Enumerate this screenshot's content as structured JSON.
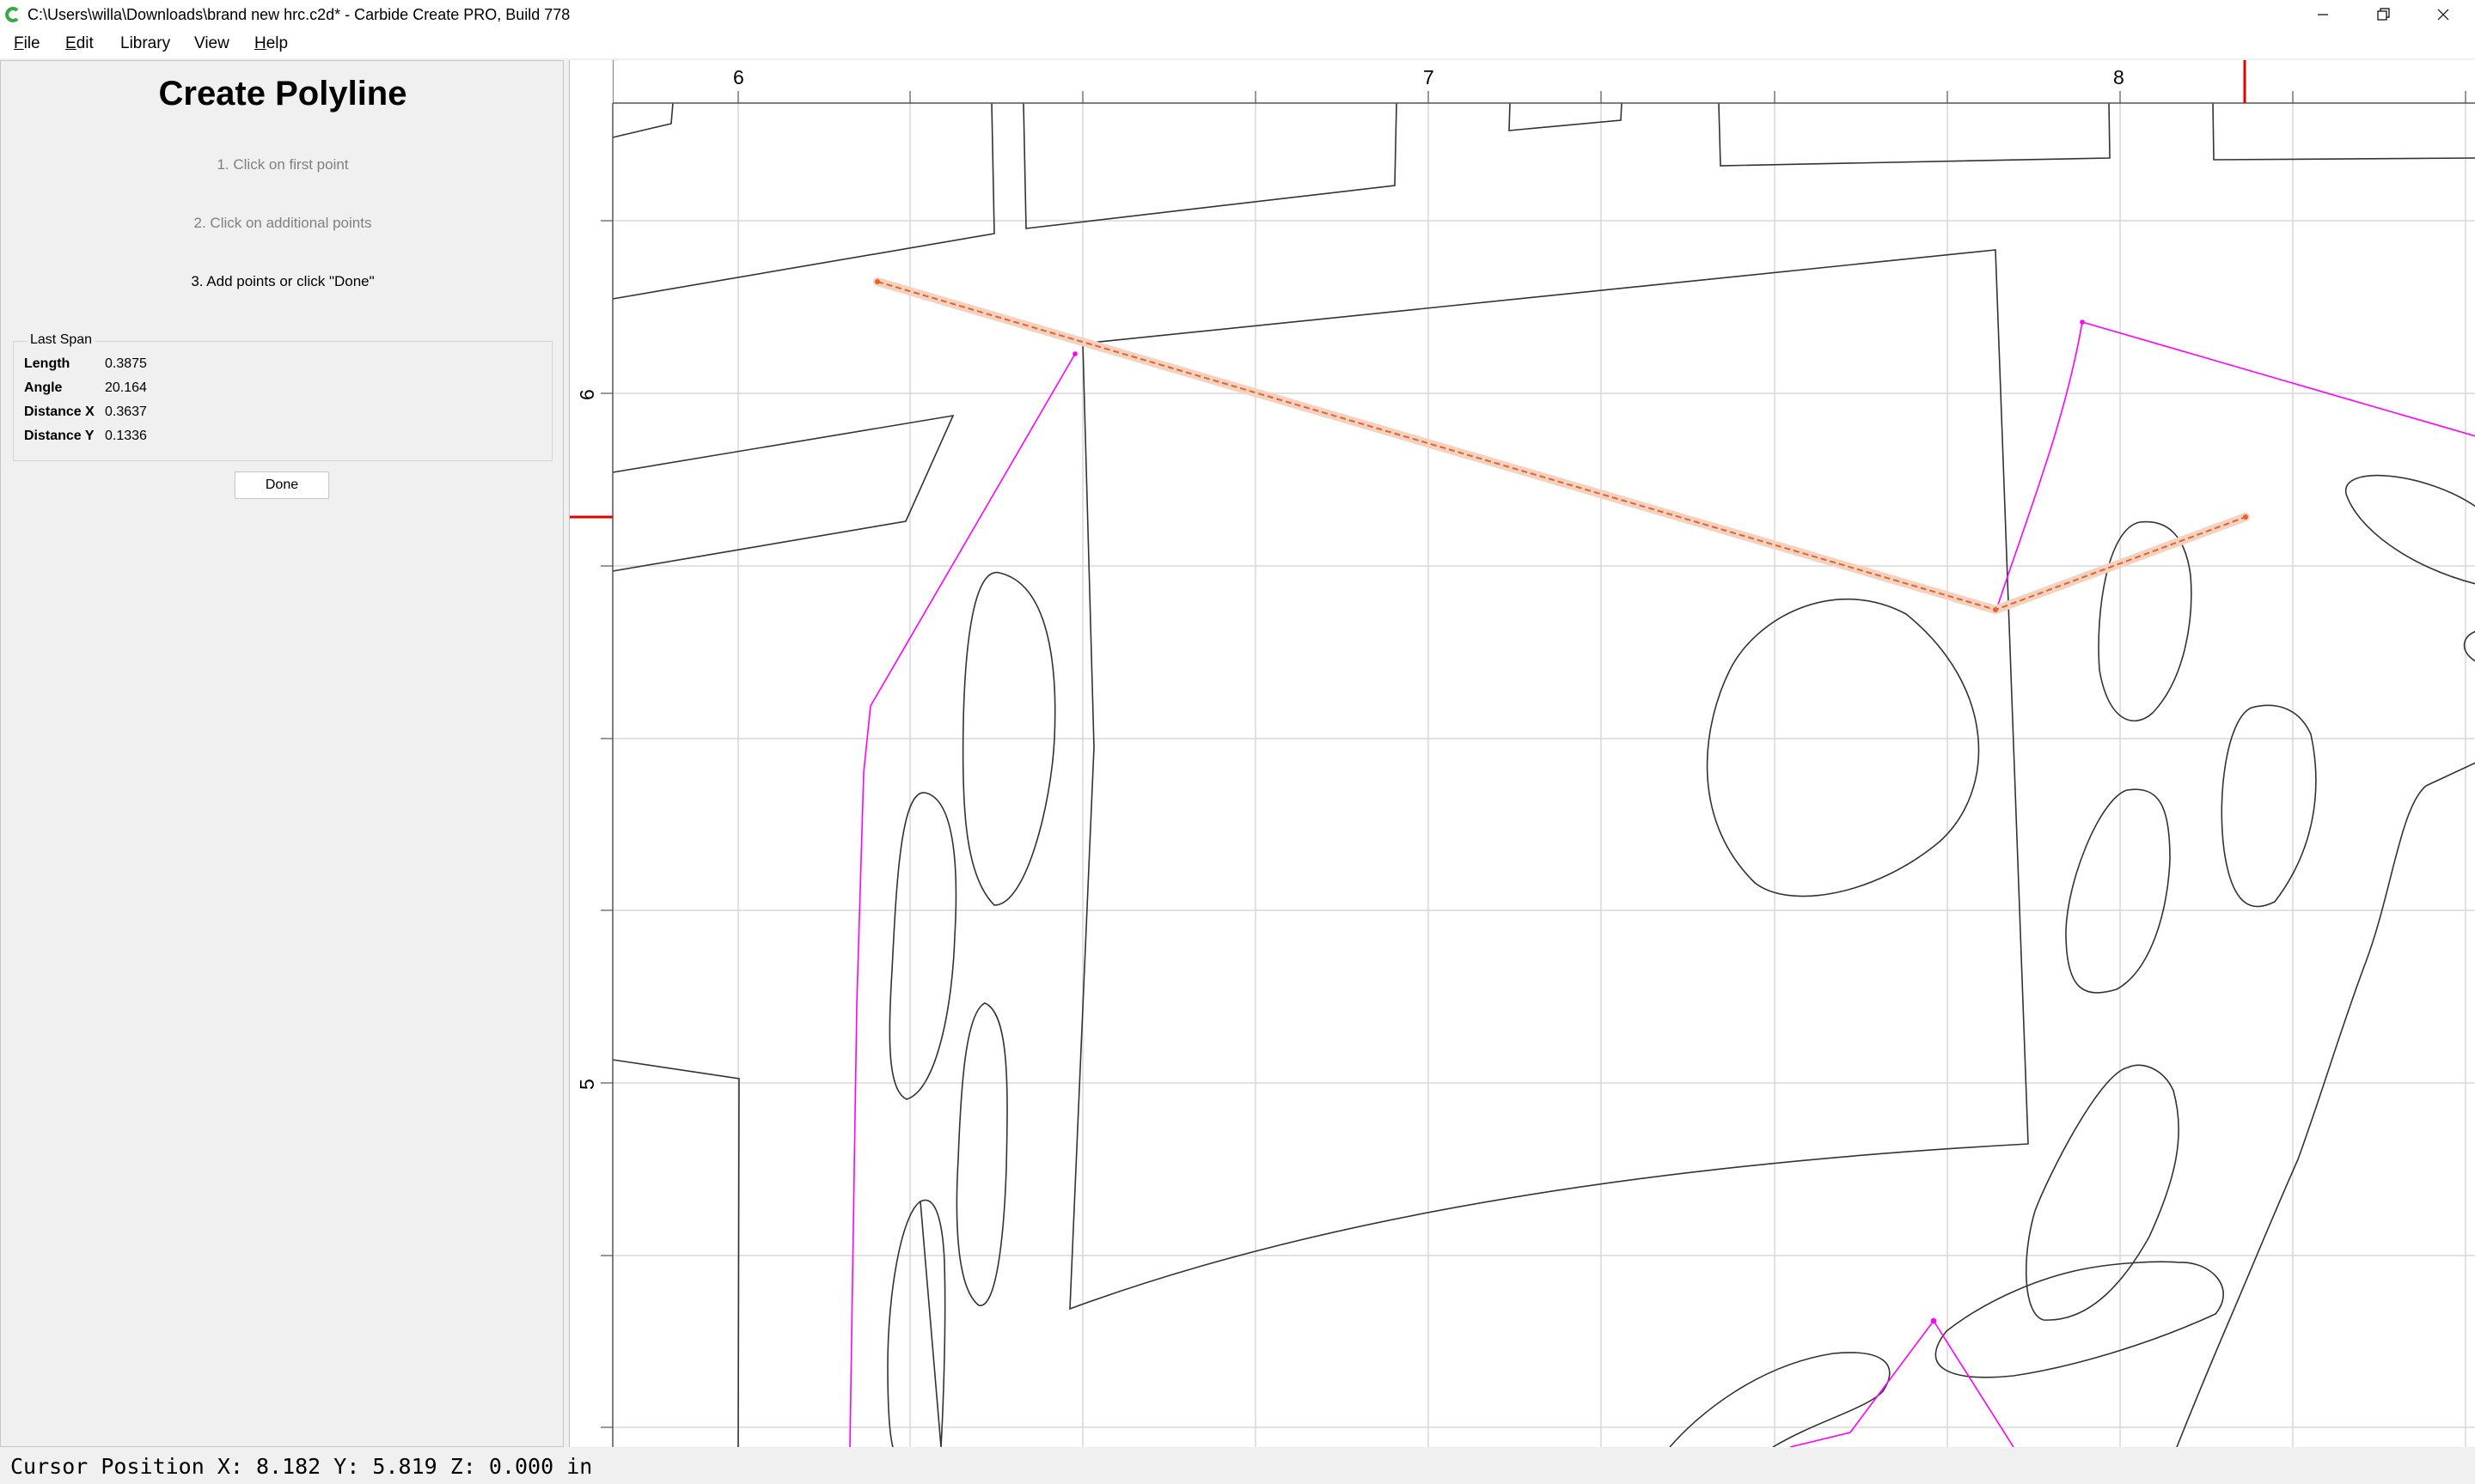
{
  "window": {
    "title": "C:\\Users\\willa\\Downloads\\brand new hrc.c2d* - Carbide Create PRO, Build 778",
    "app_icon": "carbide-create-icon",
    "controls": [
      "minimize-icon",
      "maximize-icon",
      "close-icon"
    ]
  },
  "menu": {
    "items": [
      {
        "label": "File",
        "mnemonic": "F",
        "rest": "ile"
      },
      {
        "label": "Edit",
        "mnemonic": "E",
        "rest": "dit"
      },
      {
        "label": "Library",
        "mnemonic": "",
        "rest": "Library"
      },
      {
        "label": "View",
        "mnemonic": "",
        "rest": "View"
      },
      {
        "label": "Help",
        "mnemonic": "H",
        "rest": "elp"
      }
    ]
  },
  "panel": {
    "title": "Create Polyline",
    "steps": [
      "1. Click on first point",
      "2. Click on additional points",
      "3. Add points or click \"Done\""
    ],
    "last_span": {
      "title": "Last Span",
      "length_label": "Length",
      "length_value": "0.3875",
      "angle_label": "Angle",
      "angle_value": "20.164",
      "dx_label": "Distance X",
      "dx_value": "0.3637",
      "dy_label": "Distance Y",
      "dy_value": "0.1336"
    },
    "done_label": "Done"
  },
  "canvas": {
    "ruler_x_labels": [
      "6",
      "7",
      "8"
    ],
    "ruler_y_labels": [
      "6",
      "5"
    ],
    "colors": {
      "geometry": "#333333",
      "toolpath": "#ff00ff",
      "active_polyline": "#e8622a",
      "cursor_marker": "#e00000",
      "grid": "#d8d8d8"
    }
  },
  "status": {
    "cursor_position": "Cursor Position X: 8.182 Y: 5.819 Z: 0.000 in"
  }
}
